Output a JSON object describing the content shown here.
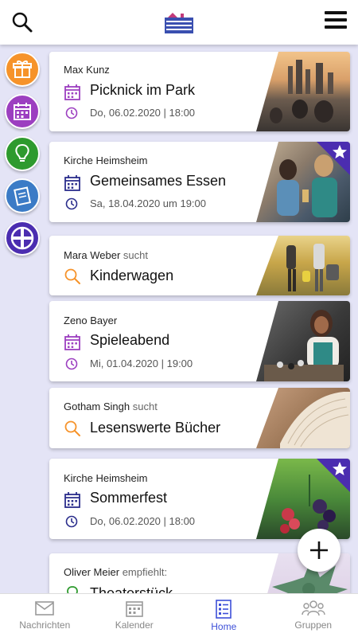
{
  "header": {
    "search_icon": "search-icon",
    "menu_icon": "hamburger-menu-icon",
    "logo": "church-app-logo"
  },
  "side_buttons": [
    {
      "icon": "gift-icon",
      "color": "#f6932a"
    },
    {
      "icon": "calendar-icon",
      "color": "#9c3fc0"
    },
    {
      "icon": "lightbulb-icon",
      "color": "#2e9a2e"
    },
    {
      "icon": "notes-icon",
      "color": "#3b7bc6"
    },
    {
      "icon": "cross-circle-icon",
      "color": "#4b2db0"
    }
  ],
  "cards": [
    {
      "author": "Max Kunz",
      "verb": "",
      "title": "Picknick im Park",
      "date": "Do, 06.02.2020 | 18:00",
      "kind": "event",
      "accent": "#9c3fc0",
      "featured": false
    },
    {
      "author": "Kirche Heimsheim",
      "verb": "",
      "title": "Gemeinsames Essen",
      "date": "Sa, 18.04.2020 um 19:00",
      "kind": "event",
      "accent": "#2b2e8c",
      "featured": true
    },
    {
      "author": "Mara Weber",
      "verb": "sucht",
      "title": "Kinderwagen",
      "date": "",
      "kind": "search",
      "accent": "#f6932a",
      "featured": false
    },
    {
      "author": "Zeno Bayer",
      "verb": "",
      "title": "Spieleabend",
      "date": "Mi, 01.04.2020 | 19:00",
      "kind": "event",
      "accent": "#9c3fc0",
      "featured": false
    },
    {
      "author": "Gotham Singh",
      "verb": "sucht",
      "title": "Lesenswerte Bücher",
      "date": "",
      "kind": "search",
      "accent": "#f6932a",
      "featured": false
    },
    {
      "author": "Kirche Heimsheim",
      "verb": "",
      "title": "Sommerfest",
      "date": "Do, 06.02.2020 | 18:00",
      "kind": "event",
      "accent": "#2b2e8c",
      "featured": true
    },
    {
      "author": "Oliver Meier",
      "verb": "empfiehlt:",
      "title": "Theaterstück",
      "date": "",
      "kind": "recommend",
      "accent": "#2e9a2e",
      "featured": false
    }
  ],
  "fab_icon": "plus-icon",
  "bottom_nav": [
    {
      "label": "Nachrichten",
      "icon": "mail-icon",
      "active": false
    },
    {
      "label": "Kalender",
      "icon": "calendar-icon",
      "active": false
    },
    {
      "label": "Home",
      "icon": "list-icon",
      "active": true
    },
    {
      "label": "Gruppen",
      "icon": "group-icon",
      "active": false
    }
  ]
}
